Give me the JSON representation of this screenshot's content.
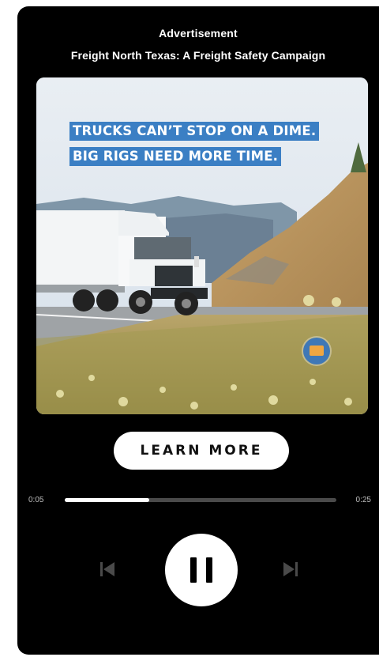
{
  "header": {
    "label": "Advertisement",
    "campaign": "Freight North Texas: A Freight Safety Campaign"
  },
  "ad": {
    "headline_line1": "TRUCKS CAN’T STOP ON A DIME.",
    "headline_line2": "BIG RIGS NEED MORE TIME.",
    "headline_bg_color": "#3b7fc4"
  },
  "cta": {
    "label": "LEARN MORE"
  },
  "player": {
    "elapsed": "0:05",
    "total": "0:25",
    "progress_fraction": 0.31,
    "state": "playing",
    "controls": {
      "previous_icon": "skip-previous-icon",
      "pause_icon": "pause-icon",
      "next_icon": "skip-next-icon"
    }
  }
}
